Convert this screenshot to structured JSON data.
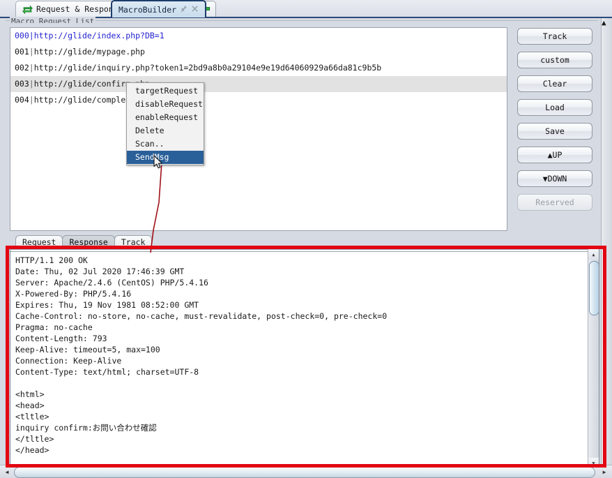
{
  "window": {
    "title": "MacroBuilder",
    "accent_blue": "#2b4a7a",
    "annotation_red": "#e30613",
    "highlight_blue": "#2a6099"
  },
  "tabs": [
    {
      "id": "request-response",
      "label": "Request & Response",
      "icon": "exchange-icon",
      "active": false
    },
    {
      "id": "macrobuilder",
      "label": "MacroBuilder",
      "icon": "none",
      "active": true,
      "pin": "pin-icon",
      "close": "close-icon"
    }
  ],
  "tab_add_button": {
    "label": "+",
    "icon": "plus-icon"
  },
  "group": {
    "label": "Macro Request List"
  },
  "request_list": {
    "rows": [
      {
        "index": "000",
        "sep": "|",
        "url": "http://glide/index.php?DB=1",
        "selected": false,
        "link": true
      },
      {
        "index": "001",
        "sep": "|",
        "url": "http://glide/mypage.php",
        "selected": false,
        "link": false
      },
      {
        "index": "002",
        "sep": "|",
        "url": "http://glide/inquiry.php?token1=2bd9a8b0a29104e9e19d64060929a66da81c9b5b",
        "selected": false,
        "link": false
      },
      {
        "index": "003",
        "sep": "|",
        "url": "http://glide/confirm.php",
        "selected": true,
        "link": false
      },
      {
        "index": "004",
        "sep": "|",
        "url": "http://glide/complete.php",
        "selected": false,
        "link": false
      }
    ]
  },
  "context_menu": {
    "items": [
      {
        "label": "targetRequest",
        "highlighted": false
      },
      {
        "label": "disableRequest",
        "highlighted": false
      },
      {
        "label": "enableRequest",
        "highlighted": false
      },
      {
        "label": "Delete",
        "highlighted": false
      },
      {
        "label": "Scan..",
        "highlighted": false
      },
      {
        "label": "SendMsg",
        "highlighted": true
      }
    ]
  },
  "side_buttons": [
    {
      "id": "track",
      "label": "Track",
      "disabled": false
    },
    {
      "id": "custom",
      "label": "custom",
      "disabled": false
    },
    {
      "id": "clear",
      "label": "Clear",
      "disabled": false
    },
    {
      "id": "load",
      "label": "Load",
      "disabled": false
    },
    {
      "id": "save",
      "label": "Save",
      "disabled": false
    },
    {
      "id": "up",
      "label": "▲UP",
      "disabled": false
    },
    {
      "id": "down",
      "label": "▼DOWN",
      "disabled": false
    },
    {
      "id": "reserved",
      "label": "Reserved",
      "disabled": true
    }
  ],
  "sub_tabs": [
    {
      "id": "request",
      "label": "Request",
      "selected": false
    },
    {
      "id": "response",
      "label": "Response",
      "selected": true
    },
    {
      "id": "track",
      "label": "Track",
      "selected": false
    }
  ],
  "response": {
    "lines": [
      "HTTP/1.1 200 OK",
      "Date: Thu, 02 Jul 2020 17:46:39 GMT",
      "Server: Apache/2.4.6 (CentOS) PHP/5.4.16",
      "X-Powered-By: PHP/5.4.16",
      "Expires: Thu, 19 Nov 1981 08:52:00 GMT",
      "Cache-Control: no-store, no-cache, must-revalidate, post-check=0, pre-check=0",
      "Pragma: no-cache",
      "Content-Length: 793",
      "Keep-Alive: timeout=5, max=100",
      "Connection: Keep-Alive",
      "Content-Type: text/html; charset=UTF-8",
      "",
      "<html>",
      "<head>",
      "<tltle>",
      "inquiry confirm:お問い合わせ確認",
      "</tltle>",
      "</head>"
    ]
  },
  "scrollbars": {
    "response_up": "▲",
    "response_down": "▼",
    "outer_up": "▲",
    "outer_down": "▼",
    "h_left": "◀",
    "h_right": "▶"
  }
}
